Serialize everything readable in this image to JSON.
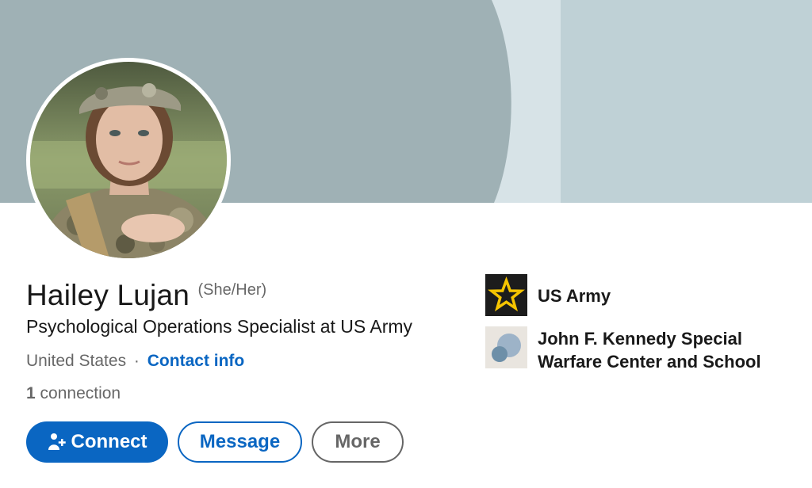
{
  "profile": {
    "name": "Hailey Lujan",
    "pronouns": "(She/Her)",
    "headline": "Psychological Operations Specialist at US Army",
    "location": "United States",
    "separator": "·",
    "contact_info_label": "Contact info",
    "connections_count": "1",
    "connections_label": "connection"
  },
  "actions": {
    "connect_label": "Connect",
    "message_label": "Message",
    "more_label": "More"
  },
  "organizations": [
    {
      "name": "US Army",
      "icon": "army-star-logo"
    },
    {
      "name_line1": "John F. Kennedy Special",
      "name_line2": "Warfare Center and School",
      "icon": "default-school-logo"
    }
  ],
  "colors": {
    "accent": "#0a66c2",
    "banner_dark": "#9fb1b5",
    "banner_mid": "#d7e3e7",
    "banner_light": "#bfd1d6",
    "army_logo_bg": "#1c1c1c",
    "army_star": "#f5c400"
  }
}
